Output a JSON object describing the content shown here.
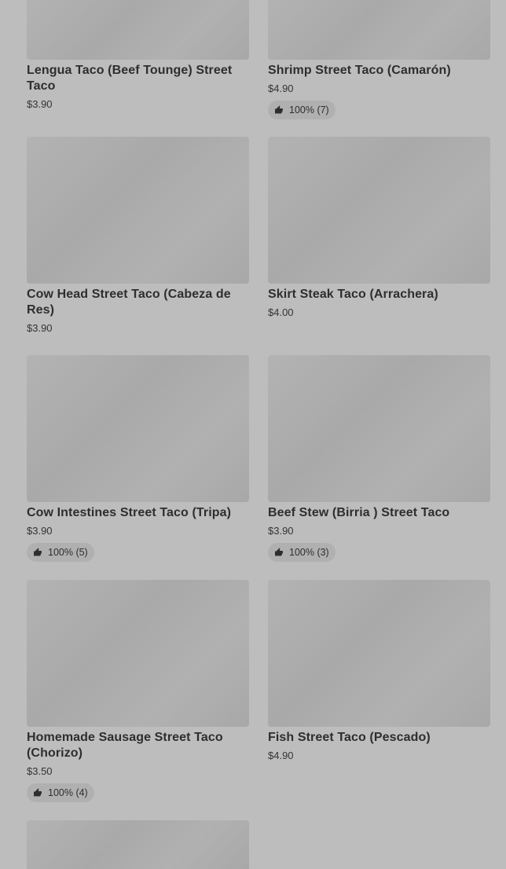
{
  "items": [
    {
      "name": "Lengua Taco (Beef Tounge) Street Taco",
      "price": "$3.90",
      "rating": ""
    },
    {
      "name": "Shrimp Street Taco (Camarón)",
      "price": "$4.90",
      "rating": "100% (7)"
    },
    {
      "name": "Cow Head Street Taco (Cabeza de Res)",
      "price": "$3.90",
      "rating": ""
    },
    {
      "name": "Skirt Steak Taco (Arrachera)",
      "price": "$4.00",
      "rating": ""
    },
    {
      "name": "Cow Intestines Street Taco (Tripa)",
      "price": "$3.90",
      "rating": "100% (5)"
    },
    {
      "name": "Beef Stew (Birria ) Street Taco",
      "price": "$3.90",
      "rating": "100% (3)"
    },
    {
      "name": "Homemade Sausage Street Taco (Chorizo)",
      "price": "$3.50",
      "rating": "100% (4)"
    },
    {
      "name": "Fish Street Taco (Pescado)",
      "price": "$4.90",
      "rating": ""
    }
  ],
  "icons": {
    "rating_icon": "thumbs-up-icon",
    "image_placeholder": "food-image"
  },
  "colors": {
    "background": "#bdbdbd",
    "image_placeholder": "#adadad",
    "rating_pill": "#b0b0b0",
    "text": "#2e2e2e"
  }
}
